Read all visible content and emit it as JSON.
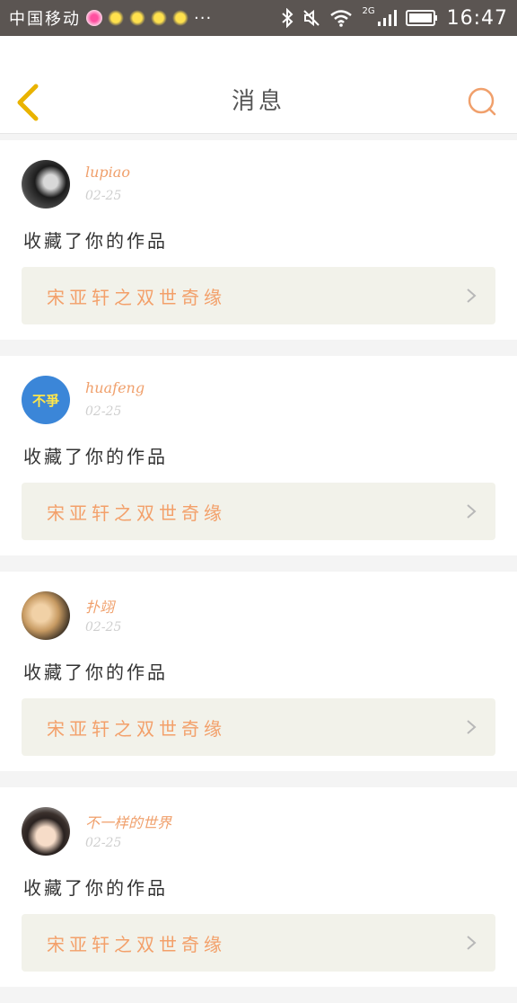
{
  "status_bar": {
    "carrier": "中国移动",
    "more": "···",
    "network": "2G",
    "time": "16:47"
  },
  "header": {
    "title": "消息"
  },
  "colors": {
    "accent": "#f0a06c",
    "back_icon": "#e9b300",
    "work_bg": "#f2f2ea"
  },
  "messages": [
    {
      "username": "lupiao",
      "date": "02-25",
      "action": "收藏了你的作品",
      "work_title": "宋亚轩之双世奇缘"
    },
    {
      "username": "huafeng",
      "date": "02-25",
      "action": "收藏了你的作品",
      "work_title": "宋亚轩之双世奇缘",
      "avatar_text": "不爭"
    },
    {
      "username": "扑翊",
      "date": "02-25",
      "action": "收藏了你的作品",
      "work_title": "宋亚轩之双世奇缘"
    },
    {
      "username": "不一样的世界",
      "date": "02-25",
      "action": "收藏了你的作品",
      "work_title": "宋亚轩之双世奇缘"
    }
  ]
}
